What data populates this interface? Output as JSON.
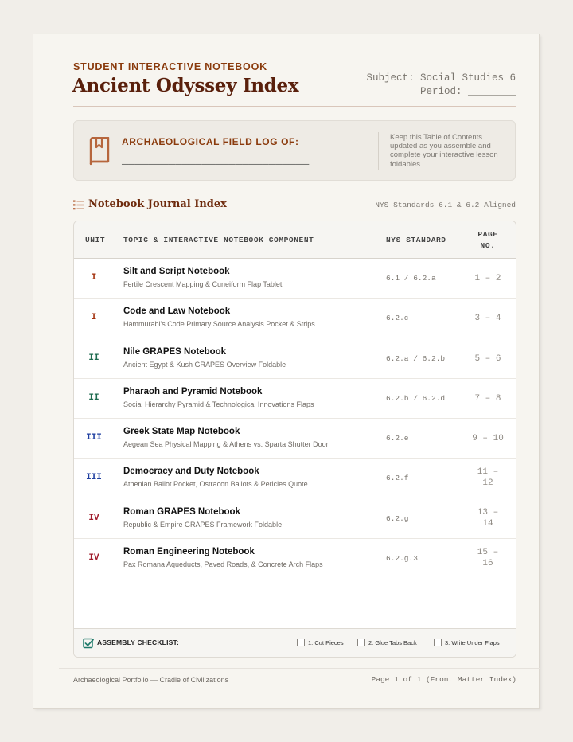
{
  "header": {
    "kicker": "STUDENT INTERACTIVE NOTEBOOK",
    "title": "Ancient Odyssey Index",
    "subject": "Subject: Social Studies 6",
    "period": "Period: ________"
  },
  "field_log": {
    "icon": "book-bookmark-icon",
    "label": "ARCHAEOLOGICAL FIELD LOG OF:",
    "blank": "____________________________",
    "note": "Keep this Table of Contents updated as you assemble and complete your interactive lesson foldables."
  },
  "section": {
    "icon": "list-icon",
    "title": "Notebook Journal Index",
    "meta": "NYS Standards 6.1 & 6.2 Aligned"
  },
  "table": {
    "headers": {
      "unit": "UNIT",
      "topic": "TOPIC & INTERACTIVE NOTEBOOK COMPONENT",
      "standard": "NYS STANDARD",
      "page_line1": "PAGE",
      "page_line2": "NO."
    },
    "rows": [
      {
        "unit": "I",
        "unit_color": "#a3300c",
        "title": "Silt and Script Notebook",
        "subtitle": "Fertile Crescent Mapping & Cuneiform Flap Tablet",
        "standard": "6.1 / 6.2.a",
        "page": "1 – 2"
      },
      {
        "unit": "I",
        "unit_color": "#a3300c",
        "title": "Code and Law Notebook",
        "subtitle": "Hammurabi's Code Primary Source Analysis Pocket & Strips",
        "standard": "6.2.c",
        "page": "3 – 4"
      },
      {
        "unit": "II",
        "unit_color": "#1f6b4f",
        "title": "Nile GRAPES Notebook",
        "subtitle": "Ancient Egypt & Kush GRAPES Overview Foldable",
        "standard": "6.2.a / 6.2.b",
        "page": "5 – 6"
      },
      {
        "unit": "II",
        "unit_color": "#1f6b4f",
        "title": "Pharaoh and Pyramid Notebook",
        "subtitle": "Social Hierarchy Pyramid & Technological Innovations Flaps",
        "standard": "6.2.b / 6.2.d",
        "page": "7 – 8"
      },
      {
        "unit": "III",
        "unit_color": "#1f3fa0",
        "title": "Greek State Map Notebook",
        "subtitle": "Aegean Sea Physical Mapping & Athens vs. Sparta Shutter Door",
        "standard": "6.2.e",
        "page": "9 – 10"
      },
      {
        "unit": "III",
        "unit_color": "#1f3fa0",
        "title": "Democracy and Duty Notebook",
        "subtitle": "Athenian Ballot Pocket, Ostracon Ballots & Pericles Quote",
        "standard": "6.2.f",
        "page_line1": "11 –",
        "page_line2": "12"
      },
      {
        "unit": "IV",
        "unit_color": "#a01c2c",
        "title": "Roman GRAPES Notebook",
        "subtitle": "Republic & Empire GRAPES Framework Foldable",
        "standard": "6.2.g",
        "page_line1": "13 –",
        "page_line2": "14"
      },
      {
        "unit": "IV",
        "unit_color": "#a01c2c",
        "title": "Roman Engineering Notebook",
        "subtitle": "Pax Romana Aqueducts, Paved Roads, & Concrete Arch Flaps",
        "standard": "6.2.g.3",
        "page_line1": "15 –",
        "page_line2": "16"
      }
    ]
  },
  "checklist": {
    "icon": "checkbox-checked-icon",
    "label": "ASSEMBLY CHECKLIST:",
    "items": [
      "1. Cut Pieces",
      "2. Glue Tabs Back",
      "3. Write Under Flaps"
    ]
  },
  "footer": {
    "left": "Archaeological Portfolio — Cradle of Civilizations",
    "right": "Page 1 of 1 (Front Matter Index)"
  },
  "colors": {
    "accent": "#8a3a0c",
    "title": "#5a200c",
    "unit_i": "#a3300c",
    "unit_ii": "#1f6b4f",
    "unit_iii": "#1f3fa0",
    "unit_iv": "#a01c2c"
  }
}
